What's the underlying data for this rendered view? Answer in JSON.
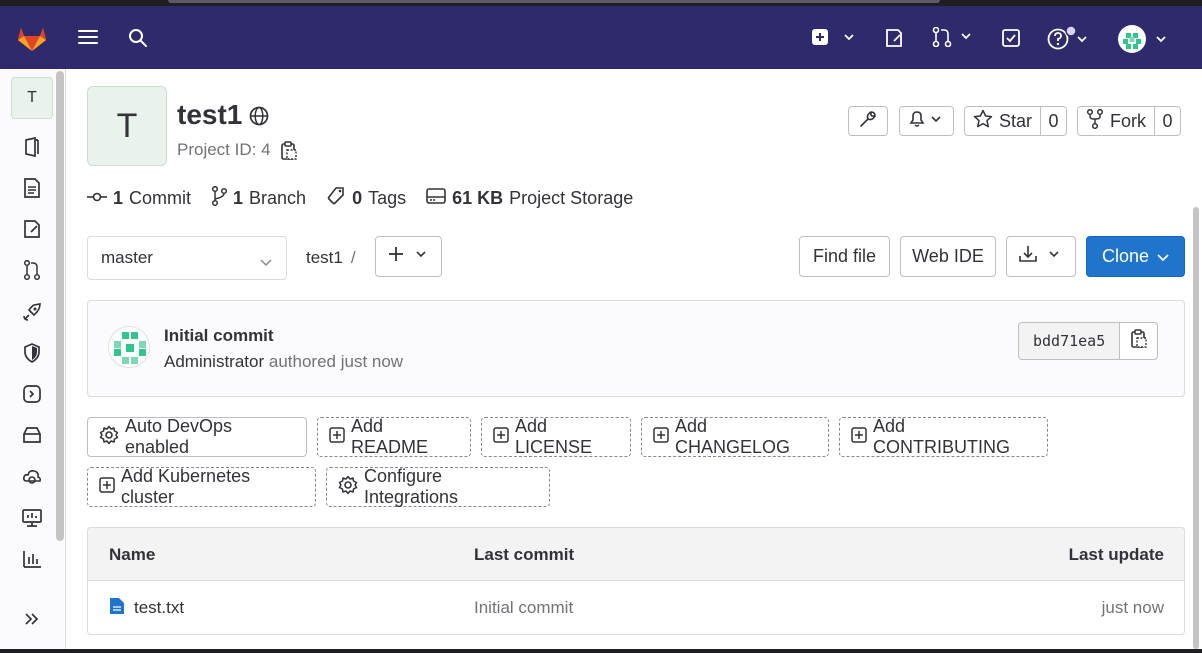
{
  "colors": {
    "navbar": "#2f2a6b",
    "primary": "#1f75cb",
    "sidebar_bg": "#fbfafd"
  },
  "navbar": {
    "icons": [
      "gitlab-logo",
      "menu-icon",
      "search-icon",
      "plus-square-icon",
      "issues-icon",
      "merge-request-icon",
      "todo-icon",
      "help-icon",
      "user-avatar"
    ]
  },
  "sidebar": {
    "project_initial": "T",
    "items": [
      "project-overview",
      "repository",
      "issues",
      "merge-requests",
      "ci-cd",
      "security",
      "deployments",
      "packages",
      "infrastructure",
      "monitor",
      "analytics"
    ]
  },
  "project": {
    "initial": "T",
    "name": "test1",
    "id_label": "Project ID: 4"
  },
  "actions": {
    "star_label": "Star",
    "star_count": "0",
    "fork_label": "Fork",
    "fork_count": "0"
  },
  "stats": {
    "commits_count": "1",
    "commits_label": "Commit",
    "branches_count": "1",
    "branches_label": "Branch",
    "tags_count": "0",
    "tags_label": "Tags",
    "storage_size": "61 KB",
    "storage_label": "Project Storage"
  },
  "repo": {
    "branch": "master",
    "path_root": "test1",
    "path_sep": "/",
    "find_file": "Find file",
    "web_ide": "Web IDE",
    "clone": "Clone"
  },
  "last_commit": {
    "title": "Initial commit",
    "author": "Administrator",
    "authored": "authored just now",
    "sha": "bdd71ea5"
  },
  "quick_actions": {
    "auto_devops": "Auto DevOps enabled",
    "add_readme": "Add README",
    "add_license": "Add LICENSE",
    "add_changelog": "Add CHANGELOG",
    "add_contributing": "Add CONTRIBUTING",
    "add_k8s": "Add Kubernetes cluster",
    "configure_integrations": "Configure Integrations"
  },
  "files_table": {
    "headers": {
      "name": "Name",
      "last_commit": "Last commit",
      "last_update": "Last update"
    },
    "rows": [
      {
        "name": "test.txt",
        "last_commit": "Initial commit",
        "last_update": "just now"
      }
    ]
  }
}
